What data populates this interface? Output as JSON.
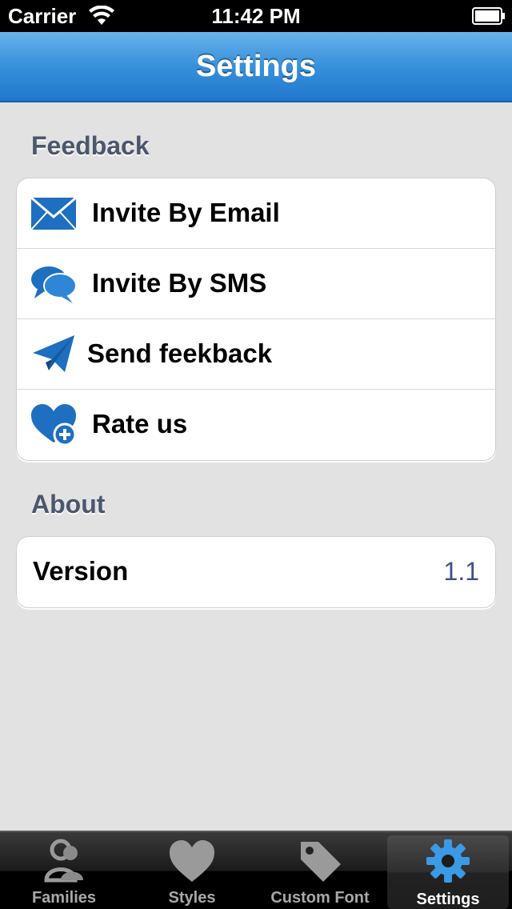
{
  "status_bar": {
    "carrier": "Carrier",
    "time": "11:42 PM"
  },
  "nav": {
    "title": "Settings"
  },
  "sections": {
    "feedback": {
      "header": "Feedback",
      "items": [
        {
          "label": "Invite By Email",
          "icon": "envelope-icon"
        },
        {
          "label": "Invite By SMS",
          "icon": "chat-bubbles-icon"
        },
        {
          "label": "Send feekback",
          "icon": "paper-plane-icon"
        },
        {
          "label": "Rate us",
          "icon": "heart-plus-icon"
        }
      ]
    },
    "about": {
      "header": "About",
      "items": [
        {
          "label": "Version",
          "value": "1.1"
        }
      ]
    }
  },
  "tabs": [
    {
      "label": "Families",
      "icon": "people-icon",
      "selected": false
    },
    {
      "label": "Styles",
      "icon": "heart-icon",
      "selected": false
    },
    {
      "label": "Custom Font",
      "icon": "tag-icon",
      "selected": false
    },
    {
      "label": "Settings",
      "icon": "gear-icon",
      "selected": true
    }
  ],
  "colors": {
    "nav_bar": "#3b93dc",
    "section_header": "#4c566c",
    "value_text": "#385487",
    "icon_blue": "#1e6fc0"
  }
}
